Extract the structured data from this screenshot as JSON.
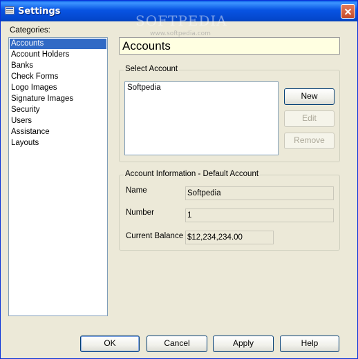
{
  "window": {
    "title": "Settings",
    "watermark": "SOFTPEDIA",
    "watermark_sub": "www.softpedia.com"
  },
  "categories": {
    "label": "Categories:",
    "items": [
      {
        "label": "Accounts",
        "selected": true
      },
      {
        "label": "Account Holders"
      },
      {
        "label": "Banks"
      },
      {
        "label": "Check Forms"
      },
      {
        "label": "Logo Images"
      },
      {
        "label": "Signature Images"
      },
      {
        "label": "Security"
      },
      {
        "label": "Users"
      },
      {
        "label": "Assistance"
      },
      {
        "label": "Layouts"
      }
    ]
  },
  "header": {
    "title": "Accounts"
  },
  "select_account": {
    "title": "Select Account",
    "items": [
      "Softpedia"
    ],
    "buttons": {
      "new": "New",
      "edit": "Edit",
      "remove": "Remove"
    }
  },
  "account_info": {
    "title": "Account Information - Default Account",
    "name_label": "Name",
    "name_value": "Softpedia",
    "number_label": "Number",
    "number_value": "1",
    "balance_label": "Current Balance",
    "balance_value": "$12,234,234.00"
  },
  "footer": {
    "ok": "OK",
    "cancel": "Cancel",
    "apply": "Apply",
    "help": "Help"
  },
  "colors": {
    "titlebar": "#0a5ee6",
    "selection": "#316ac5",
    "header_bg": "#ffffe1",
    "dialog_bg": "#ece9d8"
  }
}
